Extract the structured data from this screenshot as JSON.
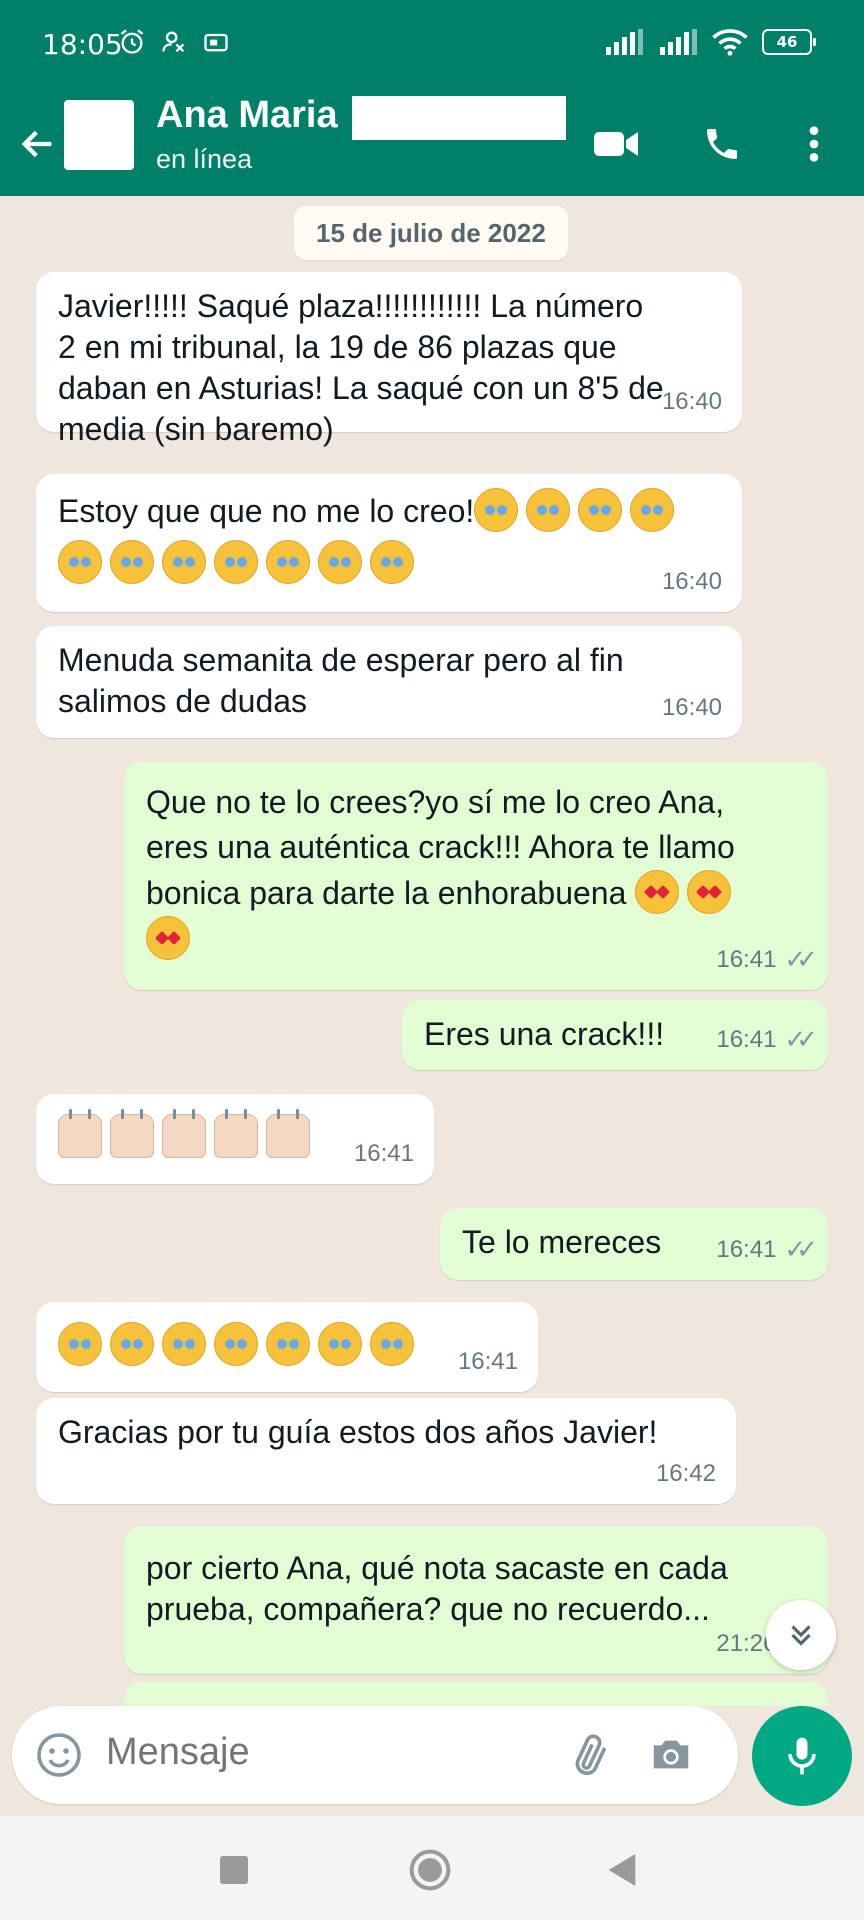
{
  "status_bar": {
    "time": "18:05",
    "battery": "46"
  },
  "header": {
    "contact_name": "Ana Maria",
    "contact_status": "en línea"
  },
  "chat": {
    "date": "15 de julio de 2022",
    "messages": [
      {
        "dir": "in",
        "text": "Javier!!!!! Saqué plaza!!!!!!!!!!!! La número\n2 en mi tribunal, la 19 de 86 plazas que\ndaban en Asturias! La saqué con un 8'5 de\nmedia (sin baremo)",
        "time": "16:40"
      },
      {
        "dir": "in",
        "text": "Estoy que que no me lo creo!",
        "time": "16:40"
      },
      {
        "dir": "in",
        "text": "Menuda semanita de esperar pero al fin\nsalimos de dudas",
        "time": "16:40"
      },
      {
        "dir": "out",
        "text": "Que no te lo crees?yo sí me lo creo Ana,\neres una auténtica crack!!! Ahora te llamo\nbonica para darte la enhorabuena",
        "time": "16:41"
      },
      {
        "dir": "out",
        "text": "Eres una crack!!!",
        "time": "16:41"
      },
      {
        "dir": "in",
        "text": "",
        "time": "16:41"
      },
      {
        "dir": "out",
        "text": "Te lo mereces",
        "time": "16:41"
      },
      {
        "dir": "in",
        "text": "",
        "time": "16:41"
      },
      {
        "dir": "in",
        "text": "Gracias por tu guía estos dos años Javier!",
        "time": "16:42"
      },
      {
        "dir": "out",
        "text": "por cierto Ana, qué nota sacaste en cada\nprueba, compañera? que no recuerdo...",
        "time": "21:26"
      }
    ]
  },
  "composer": {
    "placeholder": "Mensaje"
  },
  "icons": {
    "back": "arrow-left-icon",
    "video": "video-call-icon",
    "call": "phone-icon",
    "menu": "more-vert-icon",
    "emoji": "emoji-icon",
    "attach": "paperclip-icon",
    "camera": "camera-icon",
    "mic": "mic-icon",
    "scroll": "chevron-double-down-icon"
  },
  "colors": {
    "brand": "#008069",
    "outgoing": "#e2fdd4",
    "incoming": "#ffffff",
    "mic": "#00a884",
    "chat_bg": "#efe7dd"
  }
}
